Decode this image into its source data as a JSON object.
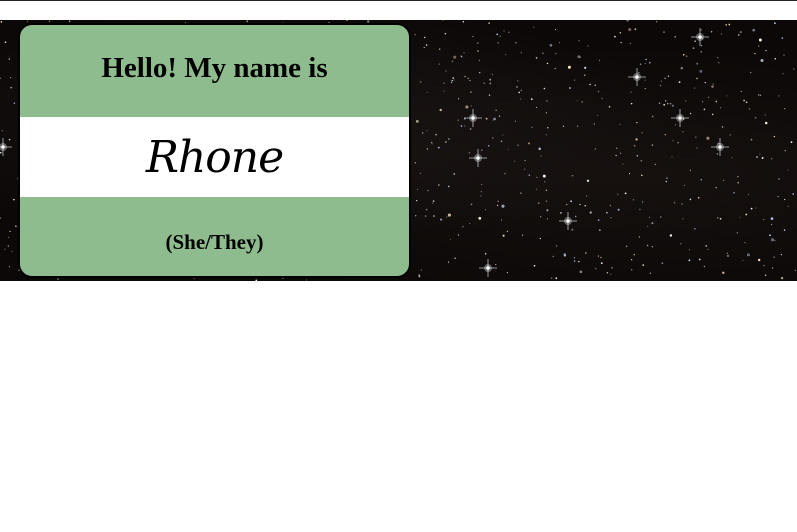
{
  "name_tag": {
    "greeting": "Hello! My name is",
    "name": "Rhone",
    "pronouns": "(She/They)"
  },
  "colors": {
    "tag_background": "#8fbc8f",
    "name_strip": "#ffffff",
    "space_background": "#0b0807"
  },
  "background_image": "starfield"
}
